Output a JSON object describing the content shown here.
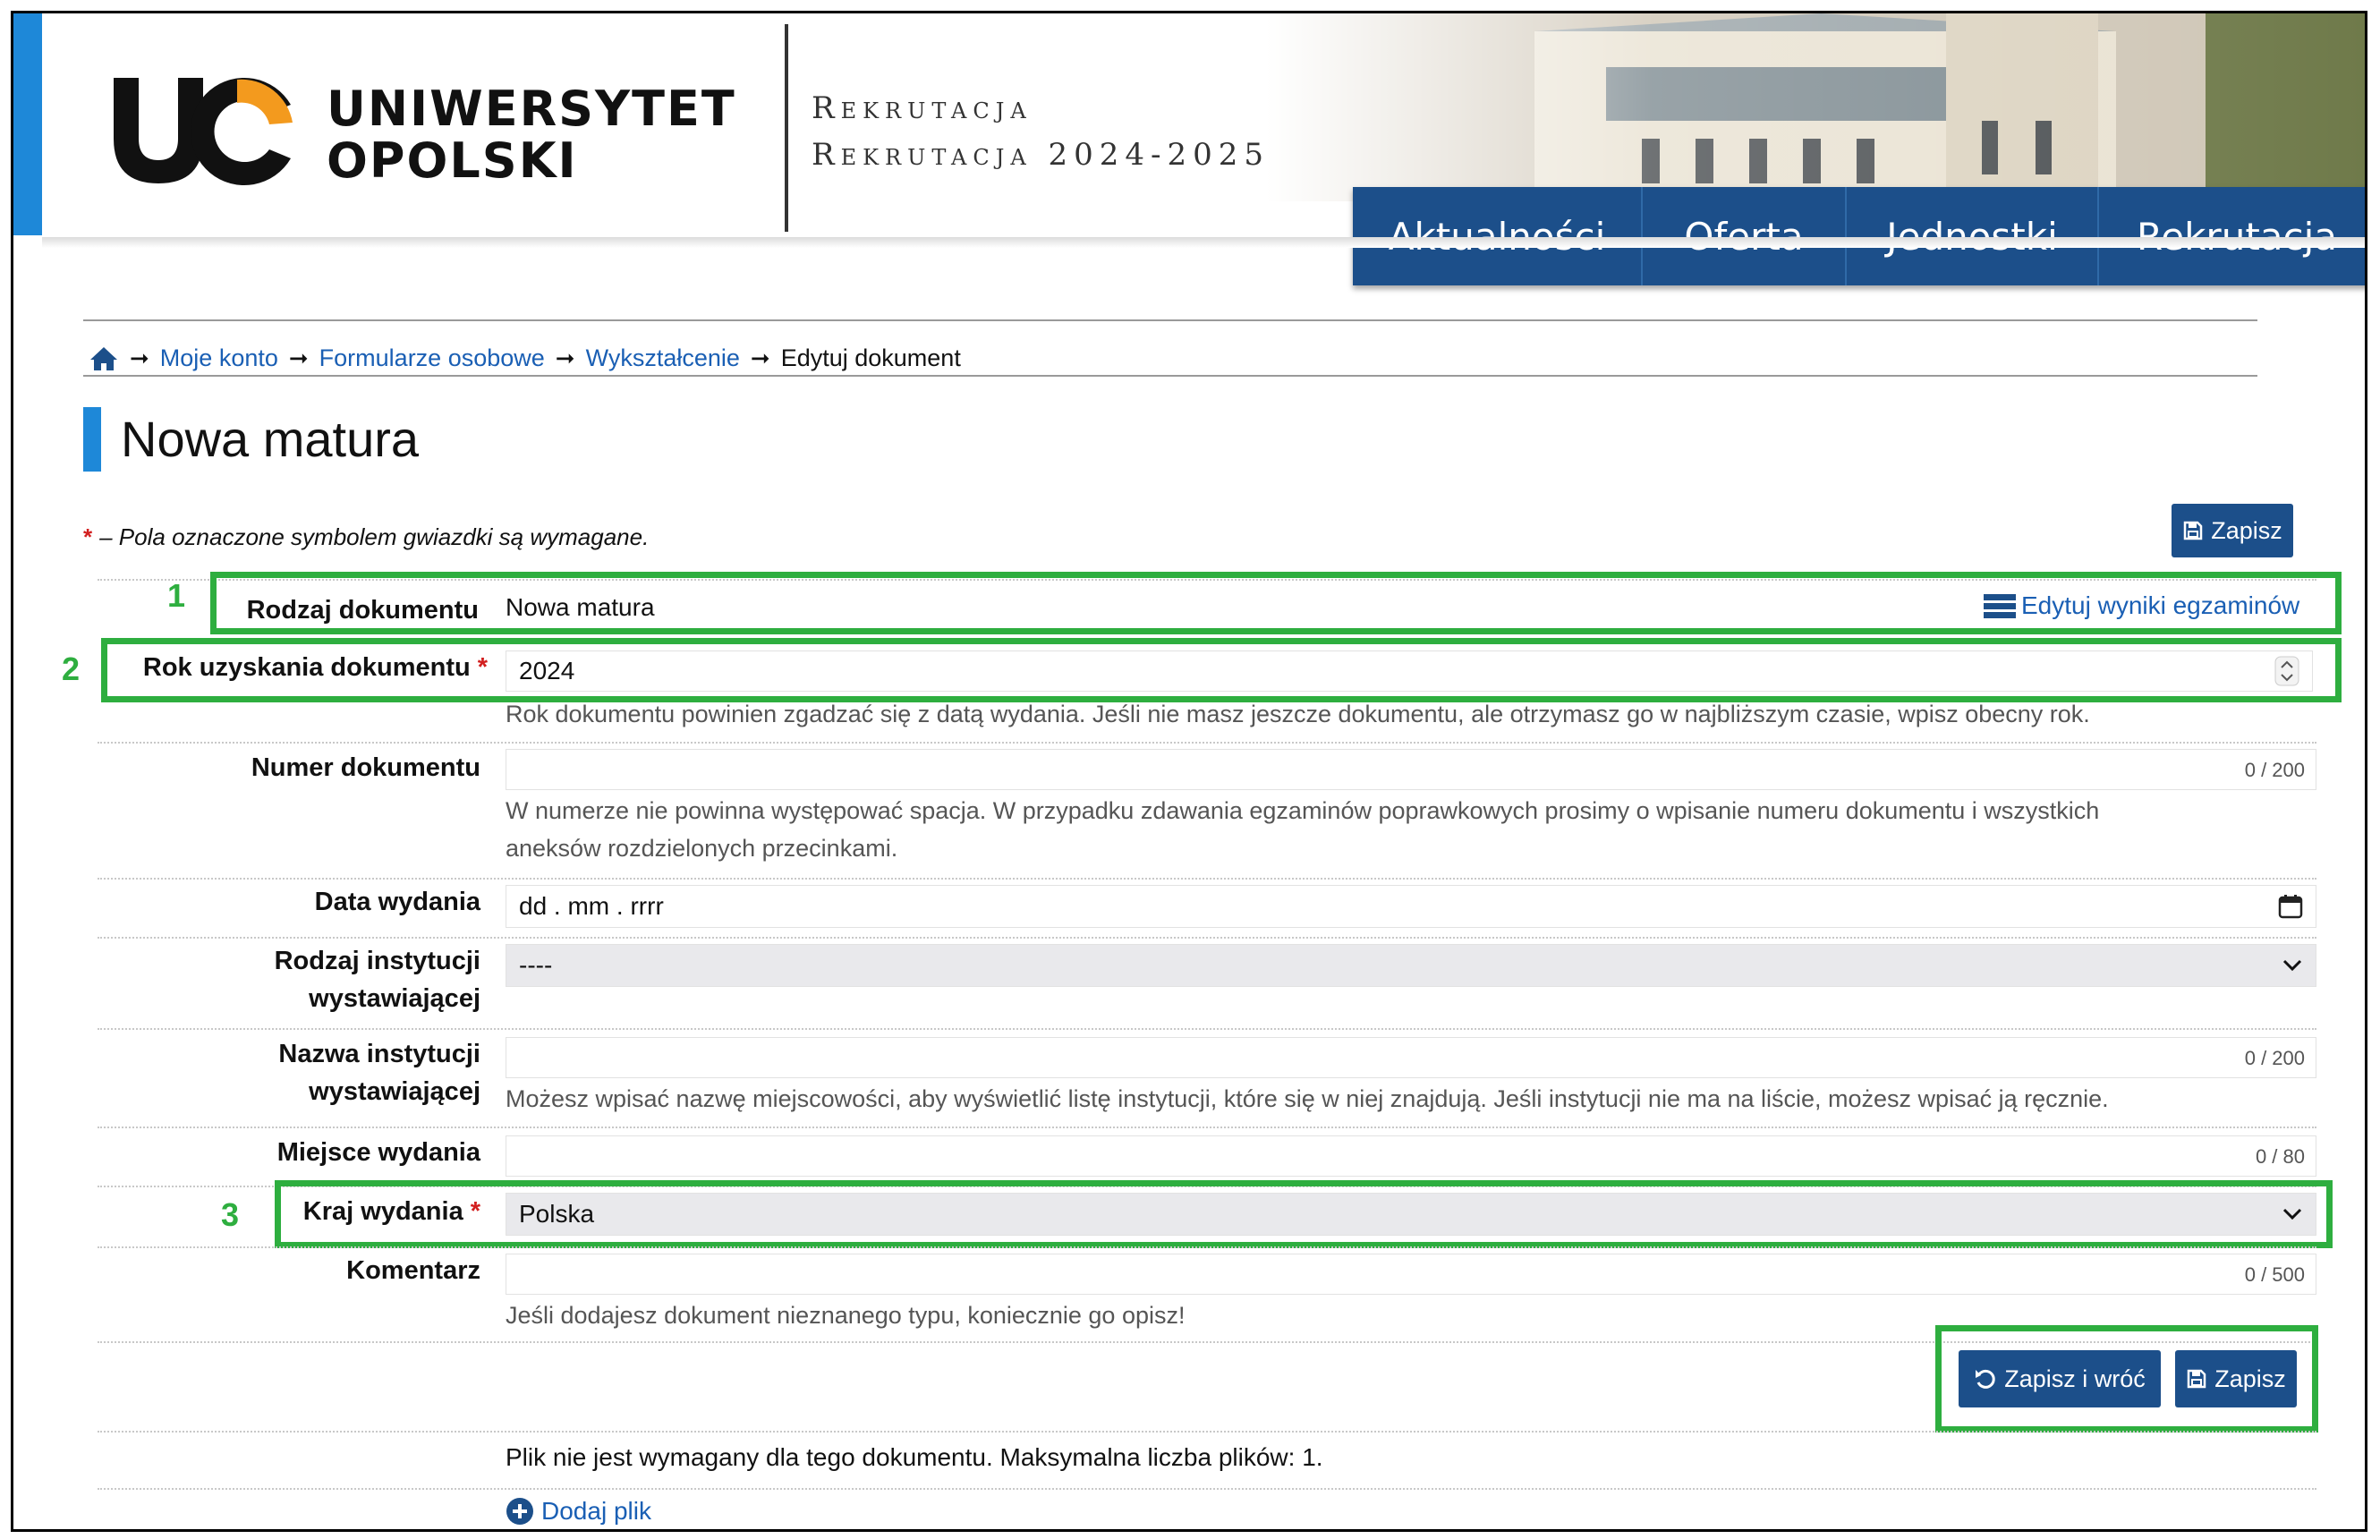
{
  "header": {
    "logo_line1": "UNIWERSYTET",
    "logo_line2": "OPOLSKI",
    "subtitle_line1": "Rekrutacja",
    "subtitle_line2": "Rekrutacja 2024-2025",
    "nav": [
      "Aktualności",
      "Oferta",
      "Jednostki",
      "Rekrutacja"
    ]
  },
  "breadcrumb": {
    "items": [
      "Moje konto",
      "Formularze osobowe",
      "Wykształcenie"
    ],
    "current": "Edytuj dokument"
  },
  "page": {
    "title": "Nowa matura",
    "required_note": "– Pola oznaczone symbolem gwiazdki są wymagane.",
    "required_star": "*",
    "save_label": "Zapisz",
    "save_return_label": "Zapisz i wróć"
  },
  "form": {
    "doc_type": {
      "label": "Rodzaj dokumentu",
      "value": "Nowa matura",
      "edit_link": "Edytuj wyniki egzaminów"
    },
    "year": {
      "label": "Rok uzyskania dokumentu",
      "value": "2024",
      "help": "Rok dokumentu powinien zgadzać się z datą wydania. Jeśli nie masz jeszcze dokumentu, ale otrzymasz go w najbliższym czasie, wpisz obecny rok."
    },
    "number": {
      "label": "Numer dokumentu",
      "value": "",
      "counter": "0 / 200",
      "help1": "W numerze nie powinna występować spacja. W przypadku zdawania egzaminów poprawkowych prosimy o wpisanie numeru dokumentu i wszystkich",
      "help2": "aneksów rozdzielonych przecinkami."
    },
    "issue_date": {
      "label": "Data wydania",
      "placeholder": "dd . mm . rrrr"
    },
    "institution_type": {
      "label1": "Rodzaj instytucji",
      "label2": "wystawiającej",
      "value": "----"
    },
    "institution_name": {
      "label1": "Nazwa instytucji",
      "label2": "wystawiającej",
      "counter": "0 / 200",
      "help": "Możesz wpisać nazwę miejscowości, aby wyświetlić listę instytucji, które się w niej znajdują. Jeśli instytucji nie ma na liście, możesz wpisać ją ręcznie."
    },
    "place": {
      "label": "Miejsce wydania",
      "counter": "0 / 80"
    },
    "country": {
      "label": "Kraj wydania",
      "value": "Polska"
    },
    "comment": {
      "label": "Komentarz",
      "counter": "0 / 500",
      "help": "Jeśli dodajesz dokument nieznanego typu, koniecznie go opisz!"
    }
  },
  "files": {
    "note": "Plik nie jest wymagany dla tego dokumentu. Maksymalna liczba plików: 1.",
    "add_label": "Dodaj plik"
  },
  "annotations": [
    "1",
    "2",
    "3"
  ],
  "colors": {
    "accent": "#1e88d8",
    "nav": "#1c4f8a",
    "link": "#1a5fb4",
    "highlight": "#2eae3f",
    "required": "#d21f1f"
  }
}
